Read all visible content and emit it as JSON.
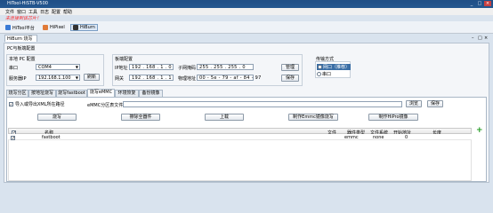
{
  "window": {
    "title": "HiTool-HiSTB-V500",
    "min": "_",
    "max": "□",
    "close": "×"
  },
  "menu": [
    "文件",
    "窗口",
    "工具",
    "日志",
    "配置",
    "帮助"
  ],
  "notice": "未连接到该芯片！",
  "toolbar": [
    {
      "label": "HiTool平台",
      "icon": "home-icon",
      "color": "#3a7bd5"
    },
    {
      "label": "HiPixel",
      "icon": "pixel-icon",
      "color": "#e07b39"
    },
    {
      "label": "HiBurn",
      "icon": "burn-icon",
      "color": "#333333"
    }
  ],
  "mdi_tab": {
    "label": "HiBurn 烧写",
    "close": "×"
  },
  "mdi_controls": {
    "min": "–",
    "max": "□",
    "close": "×"
  },
  "pc_group": {
    "title": "PC与板端配置",
    "local": {
      "title": "本地 PC 配置",
      "port_label": "串口",
      "port_value": "COM4",
      "server_label": "服务器IP",
      "server_value": "192.168.1.100",
      "refresh": "刷新"
    },
    "board": {
      "title": "板端配置",
      "ip_label": "IP地址",
      "ip_value": "192 . 168 . 1 . 0",
      "gw_label": "网关",
      "gw_value": "192 . 168 . 1 . 1",
      "mask_label": "子网掩码",
      "mask_value": "255 . 255 . 255 . 0",
      "mac_label": "物理地址",
      "mac_value": "00 - 5e - 79 - af - 84 - 97",
      "manage": "管理",
      "save": "保存"
    },
    "transfer": {
      "title": "传输方式",
      "opt1": "网口（推荐）",
      "opt2": "串口"
    }
  },
  "tabs": [
    "烧写分区",
    "按地址烧写",
    "烧写fastboot",
    "烧写eMMC",
    "环境恢复",
    "备份镜像"
  ],
  "active_tab": 3,
  "emmc": {
    "checkbox_label": "导入或导出XML所在路径",
    "path_label": "eMMC分区表文件",
    "browse": "浏览",
    "save": "保存",
    "buttons": [
      "烧写",
      "擦除全器件",
      "上载",
      "制作Emmc镜像烧写",
      "制作HiPro镜像"
    ],
    "columns": [
      "名称",
      "文件",
      "器件类型",
      "文件系统",
      "开始地址",
      "长度"
    ],
    "rows": [
      {
        "name": "fastboot",
        "file": "",
        "device": "emmc",
        "fs": "none",
        "start": "0",
        "length": ""
      }
    ],
    "add": "+"
  }
}
